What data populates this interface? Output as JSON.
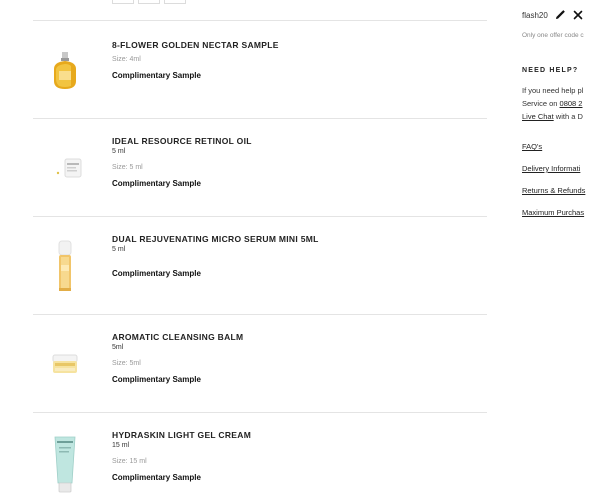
{
  "cart": {
    "items": [
      {
        "name": "8-FLOWER GOLDEN NECTAR SAMPLE",
        "subtitle": "",
        "size": "Size: 4ml",
        "status": "Complimentary Sample"
      },
      {
        "name": "IDEAL RESOURCE RETINOL OIL",
        "subtitle": "5 ml",
        "size": "Size: 5 ml",
        "status": "Complimentary Sample"
      },
      {
        "name": "DUAL REJUVENATING MICRO SERUM MINI 5ML",
        "subtitle": "5 ml",
        "size": "",
        "status": "Complimentary Sample"
      },
      {
        "name": "AROMATIC CLEANSING BALM",
        "subtitle": "5ml",
        "size": "Size: 5ml",
        "status": "Complimentary Sample"
      },
      {
        "name": "HYDRASKIN LIGHT GEL CREAM",
        "subtitle": "15 ml",
        "size": "Size: 15 ml",
        "status": "Complimentary Sample"
      }
    ]
  },
  "sidebar": {
    "promo_code": "flash20",
    "promo_note": "Only one offer code c",
    "help_heading": "NEED HELP?",
    "help_line1": "If you need help pl",
    "help_line2_prefix": "Service on ",
    "help_phone": "0808 2",
    "help_line3_link": "Live Chat",
    "help_line3_suffix": " with a D",
    "links": [
      "FAQ's",
      "Delivery Informati",
      "Returns & Refunds",
      "Maximum Purchas"
    ]
  }
}
